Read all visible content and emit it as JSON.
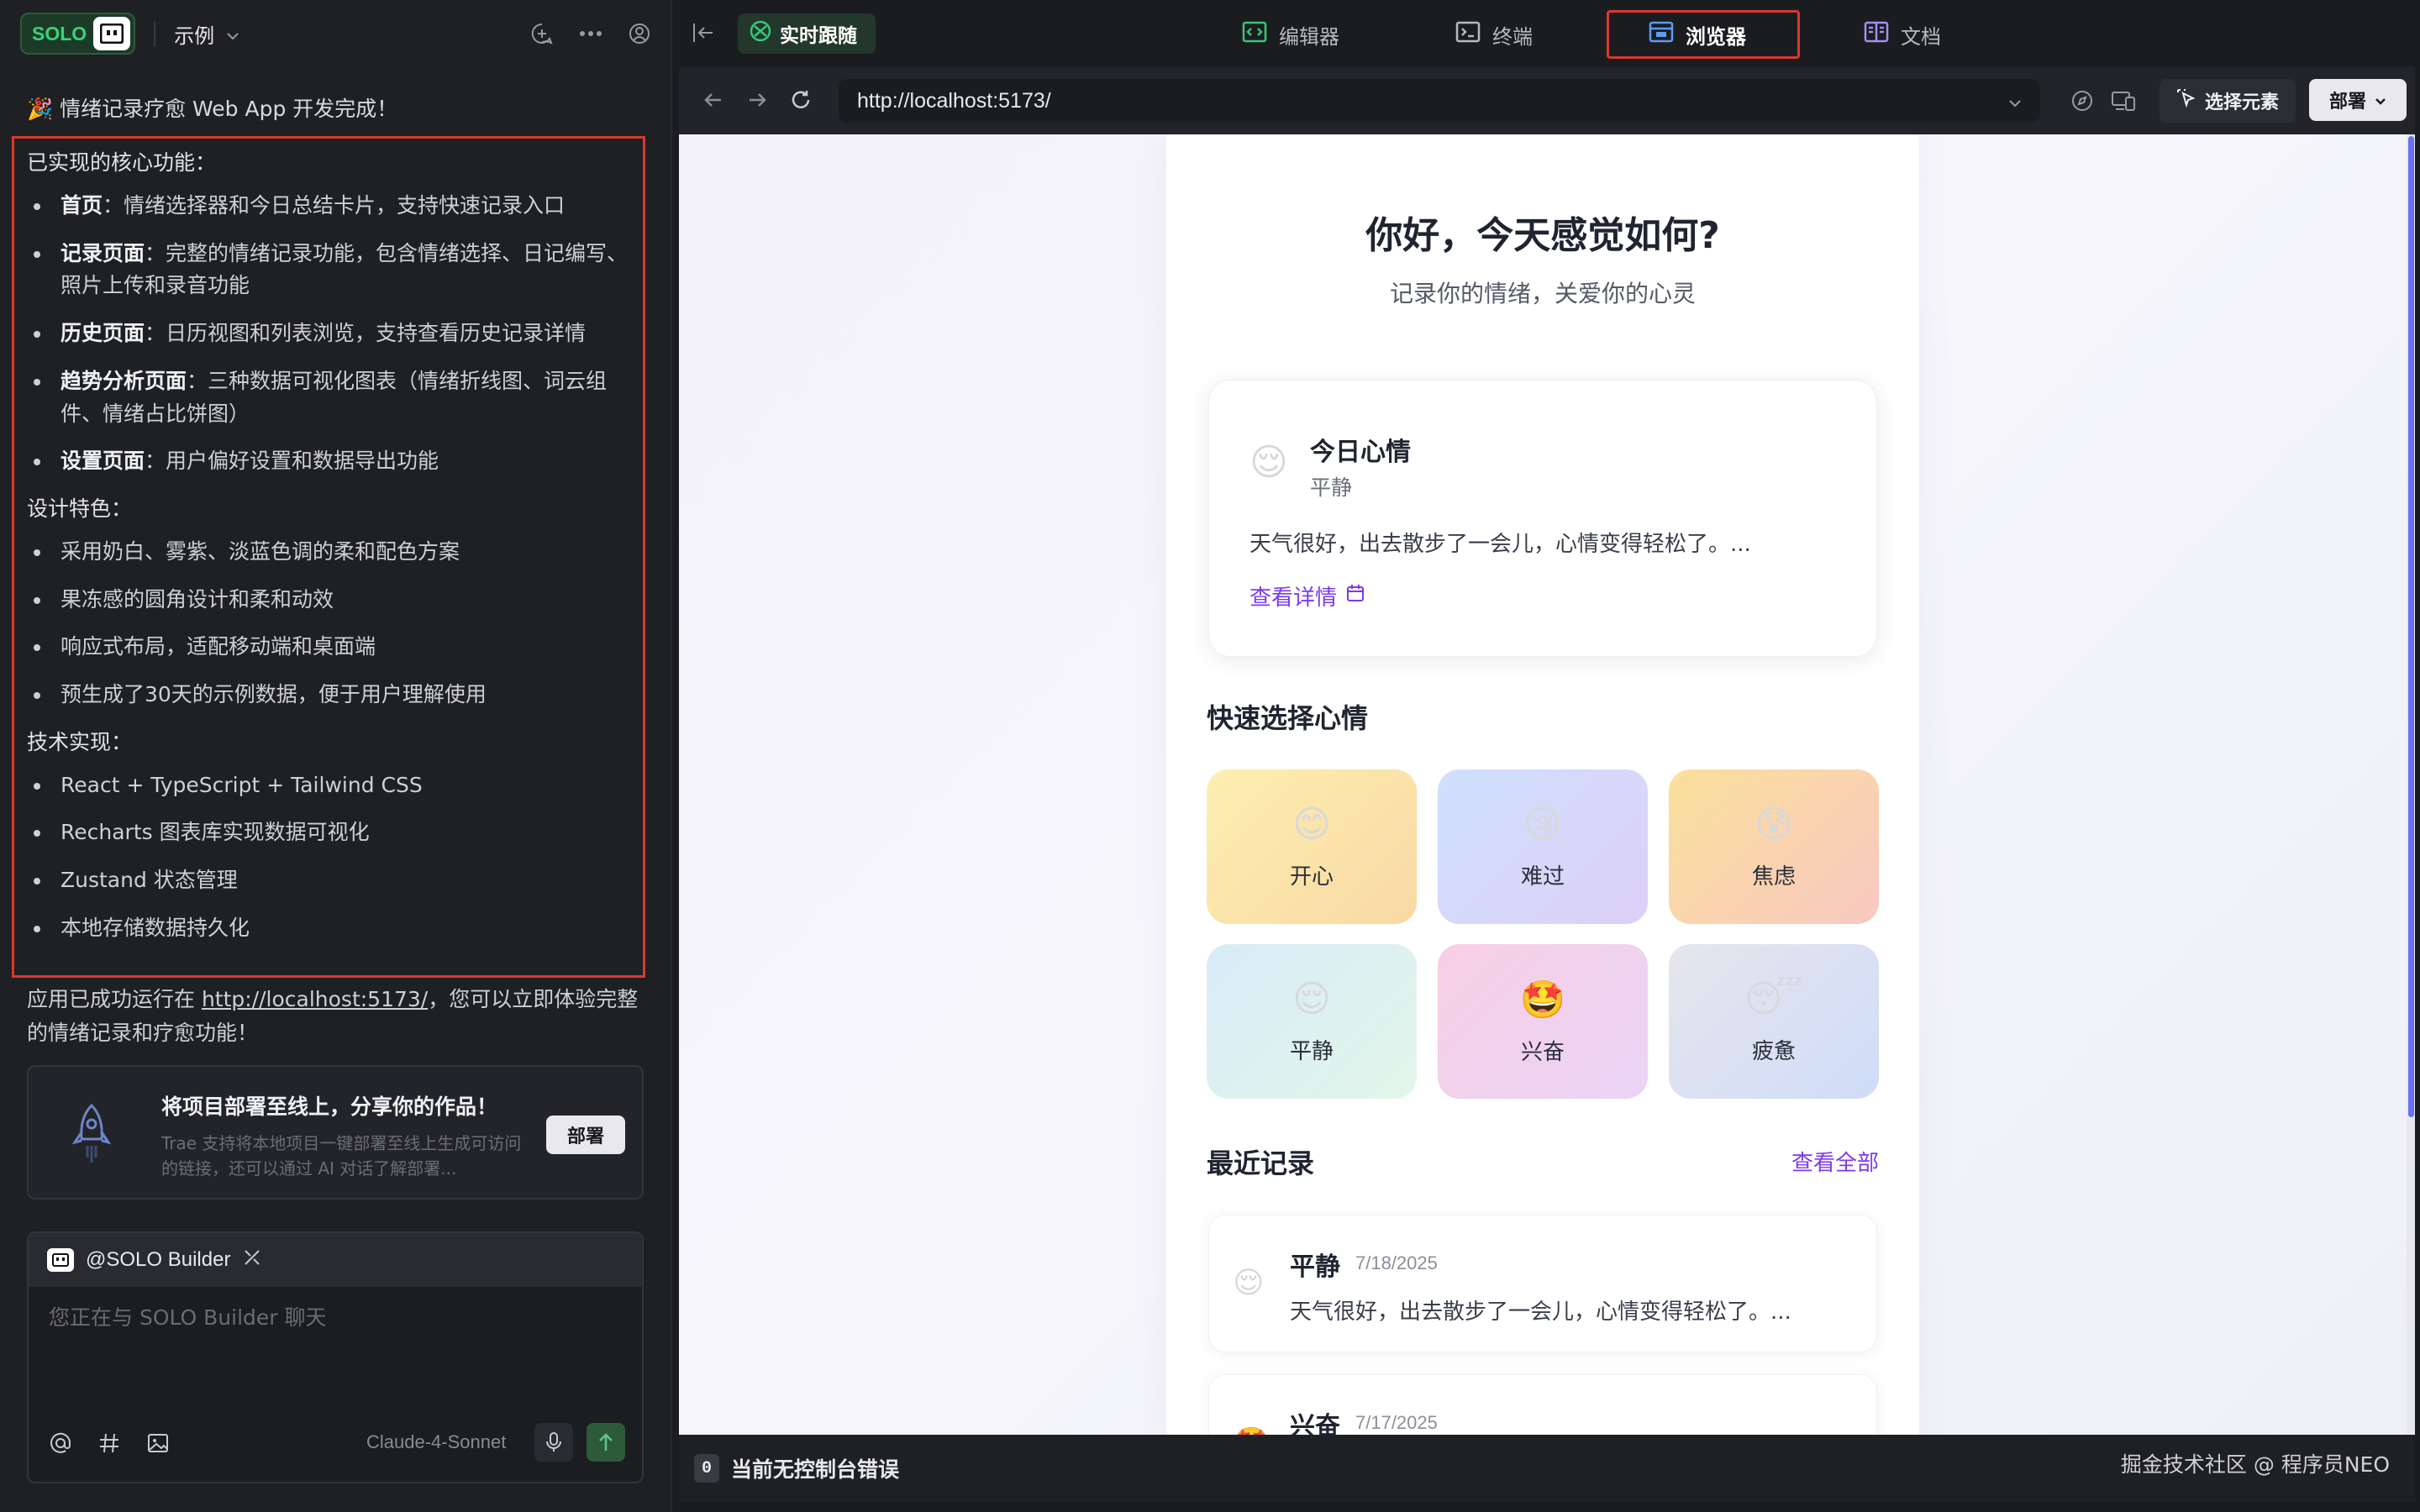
{
  "left": {
    "solo_label": "SOLO",
    "project_name": "示例",
    "intro_message": "🎉 情绪记录疗愈 Web App 开发完成！",
    "sections": [
      {
        "title": "已实现的核心功能：",
        "items": [
          {
            "bold": "首页",
            "text": "：情绪选择器和今日总结卡片，支持快速记录入口"
          },
          {
            "bold": "记录页面",
            "text": "：完整的情绪记录功能，包含情绪选择、日记编写、照片上传和录音功能"
          },
          {
            "bold": "历史页面",
            "text": "：日历视图和列表浏览，支持查看历史记录详情"
          },
          {
            "bold": "趋势分析页面",
            "text": "：三种数据可视化图表（情绪折线图、词云组件、情绪占比饼图）"
          },
          {
            "bold": "设置页面",
            "text": "：用户偏好设置和数据导出功能"
          }
        ]
      },
      {
        "title": "设计特色：",
        "items": [
          {
            "bold": "",
            "text": "采用奶白、雾紫、淡蓝色调的柔和配色方案"
          },
          {
            "bold": "",
            "text": "果冻感的圆角设计和柔和动效"
          },
          {
            "bold": "",
            "text": "响应式布局，适配移动端和桌面端"
          },
          {
            "bold": "",
            "text": "预生成了30天的示例数据，便于用户理解使用"
          }
        ]
      },
      {
        "title": "技术实现：",
        "items": [
          {
            "bold": "",
            "text": "React + TypeScript + Tailwind CSS"
          },
          {
            "bold": "",
            "text": "Recharts 图表库实现数据可视化"
          },
          {
            "bold": "",
            "text": "Zustand 状态管理"
          },
          {
            "bold": "",
            "text": "本地存储数据持久化"
          }
        ]
      }
    ],
    "after_prefix": "应用已成功运行在 ",
    "after_link": "http://localhost:5173/",
    "after_suffix": "，您可以立即体验完整的情绪记录和疗愈功能！",
    "deploy_card": {
      "title": "将项目部署至线上，分享你的作品！",
      "desc": "Trae 支持将本地项目一键部署至线上生成可访问的链接，还可以通过 AI 对话了解部署...",
      "button": "部署"
    },
    "chat": {
      "agent": "@SOLO Builder",
      "placeholder": "您正在与 SOLO Builder 聊天",
      "model": "Claude-4-Sonnet"
    }
  },
  "right": {
    "live_follow": "实时跟随",
    "tabs": [
      {
        "label": "编辑器",
        "icon": "code-icon"
      },
      {
        "label": "终端",
        "icon": "terminal-icon"
      },
      {
        "label": "浏览器",
        "icon": "browser-icon"
      },
      {
        "label": "文档",
        "icon": "docs-icon"
      }
    ],
    "active_tab": "浏览器",
    "url": "http://localhost:5173/",
    "select_element": "选择元素",
    "deploy": "部署",
    "console_count": "0",
    "console_text": "当前无控制台错误",
    "watermark": "掘金技术社区 @ 程序员NEO"
  },
  "app": {
    "greeting": "你好，今天感觉如何?",
    "subtitle": "记录你的情绪，关爱你的心灵",
    "today": {
      "emoji": "😌",
      "title": "今日心情",
      "mood": "平静",
      "desc": "天气很好，出去散步了一会儿，心情变得轻松了。...",
      "link": "查看详情"
    },
    "quick_title": "快速选择心情",
    "moods": [
      {
        "emoji": "😊",
        "label": "开心",
        "bg": "linear-gradient(135deg,#fdeeb0,#f9d9a4)"
      },
      {
        "emoji": "😢",
        "label": "难过",
        "bg": "linear-gradient(135deg,#cfe0fc,#ddd0f7)"
      },
      {
        "emoji": "😰",
        "label": "焦虑",
        "bg": "linear-gradient(135deg,#fbe09a,#f8c8c2)"
      },
      {
        "emoji": "😌",
        "label": "平静",
        "bg": "linear-gradient(135deg,#d8ecf8,#e2f6ea)"
      },
      {
        "emoji": "🤩",
        "label": "兴奋",
        "bg": "linear-gradient(135deg,#f7cfe4,#ead4f6)"
      },
      {
        "emoji": "😴",
        "label": "疲惫",
        "bg": "linear-gradient(135deg,#e6e6ec,#cfdcf8)"
      }
    ],
    "recent_title": "最近记录",
    "recent_all": "查看全部",
    "records": [
      {
        "emoji": "😌",
        "mood": "平静",
        "date": "7/18/2025",
        "text": "天气很好，出去散步了一会儿，心情变得轻松了。..."
      },
      {
        "emoji": "🤩",
        "mood": "兴奋",
        "date": "7/17/2025",
        "text": ""
      }
    ]
  }
}
